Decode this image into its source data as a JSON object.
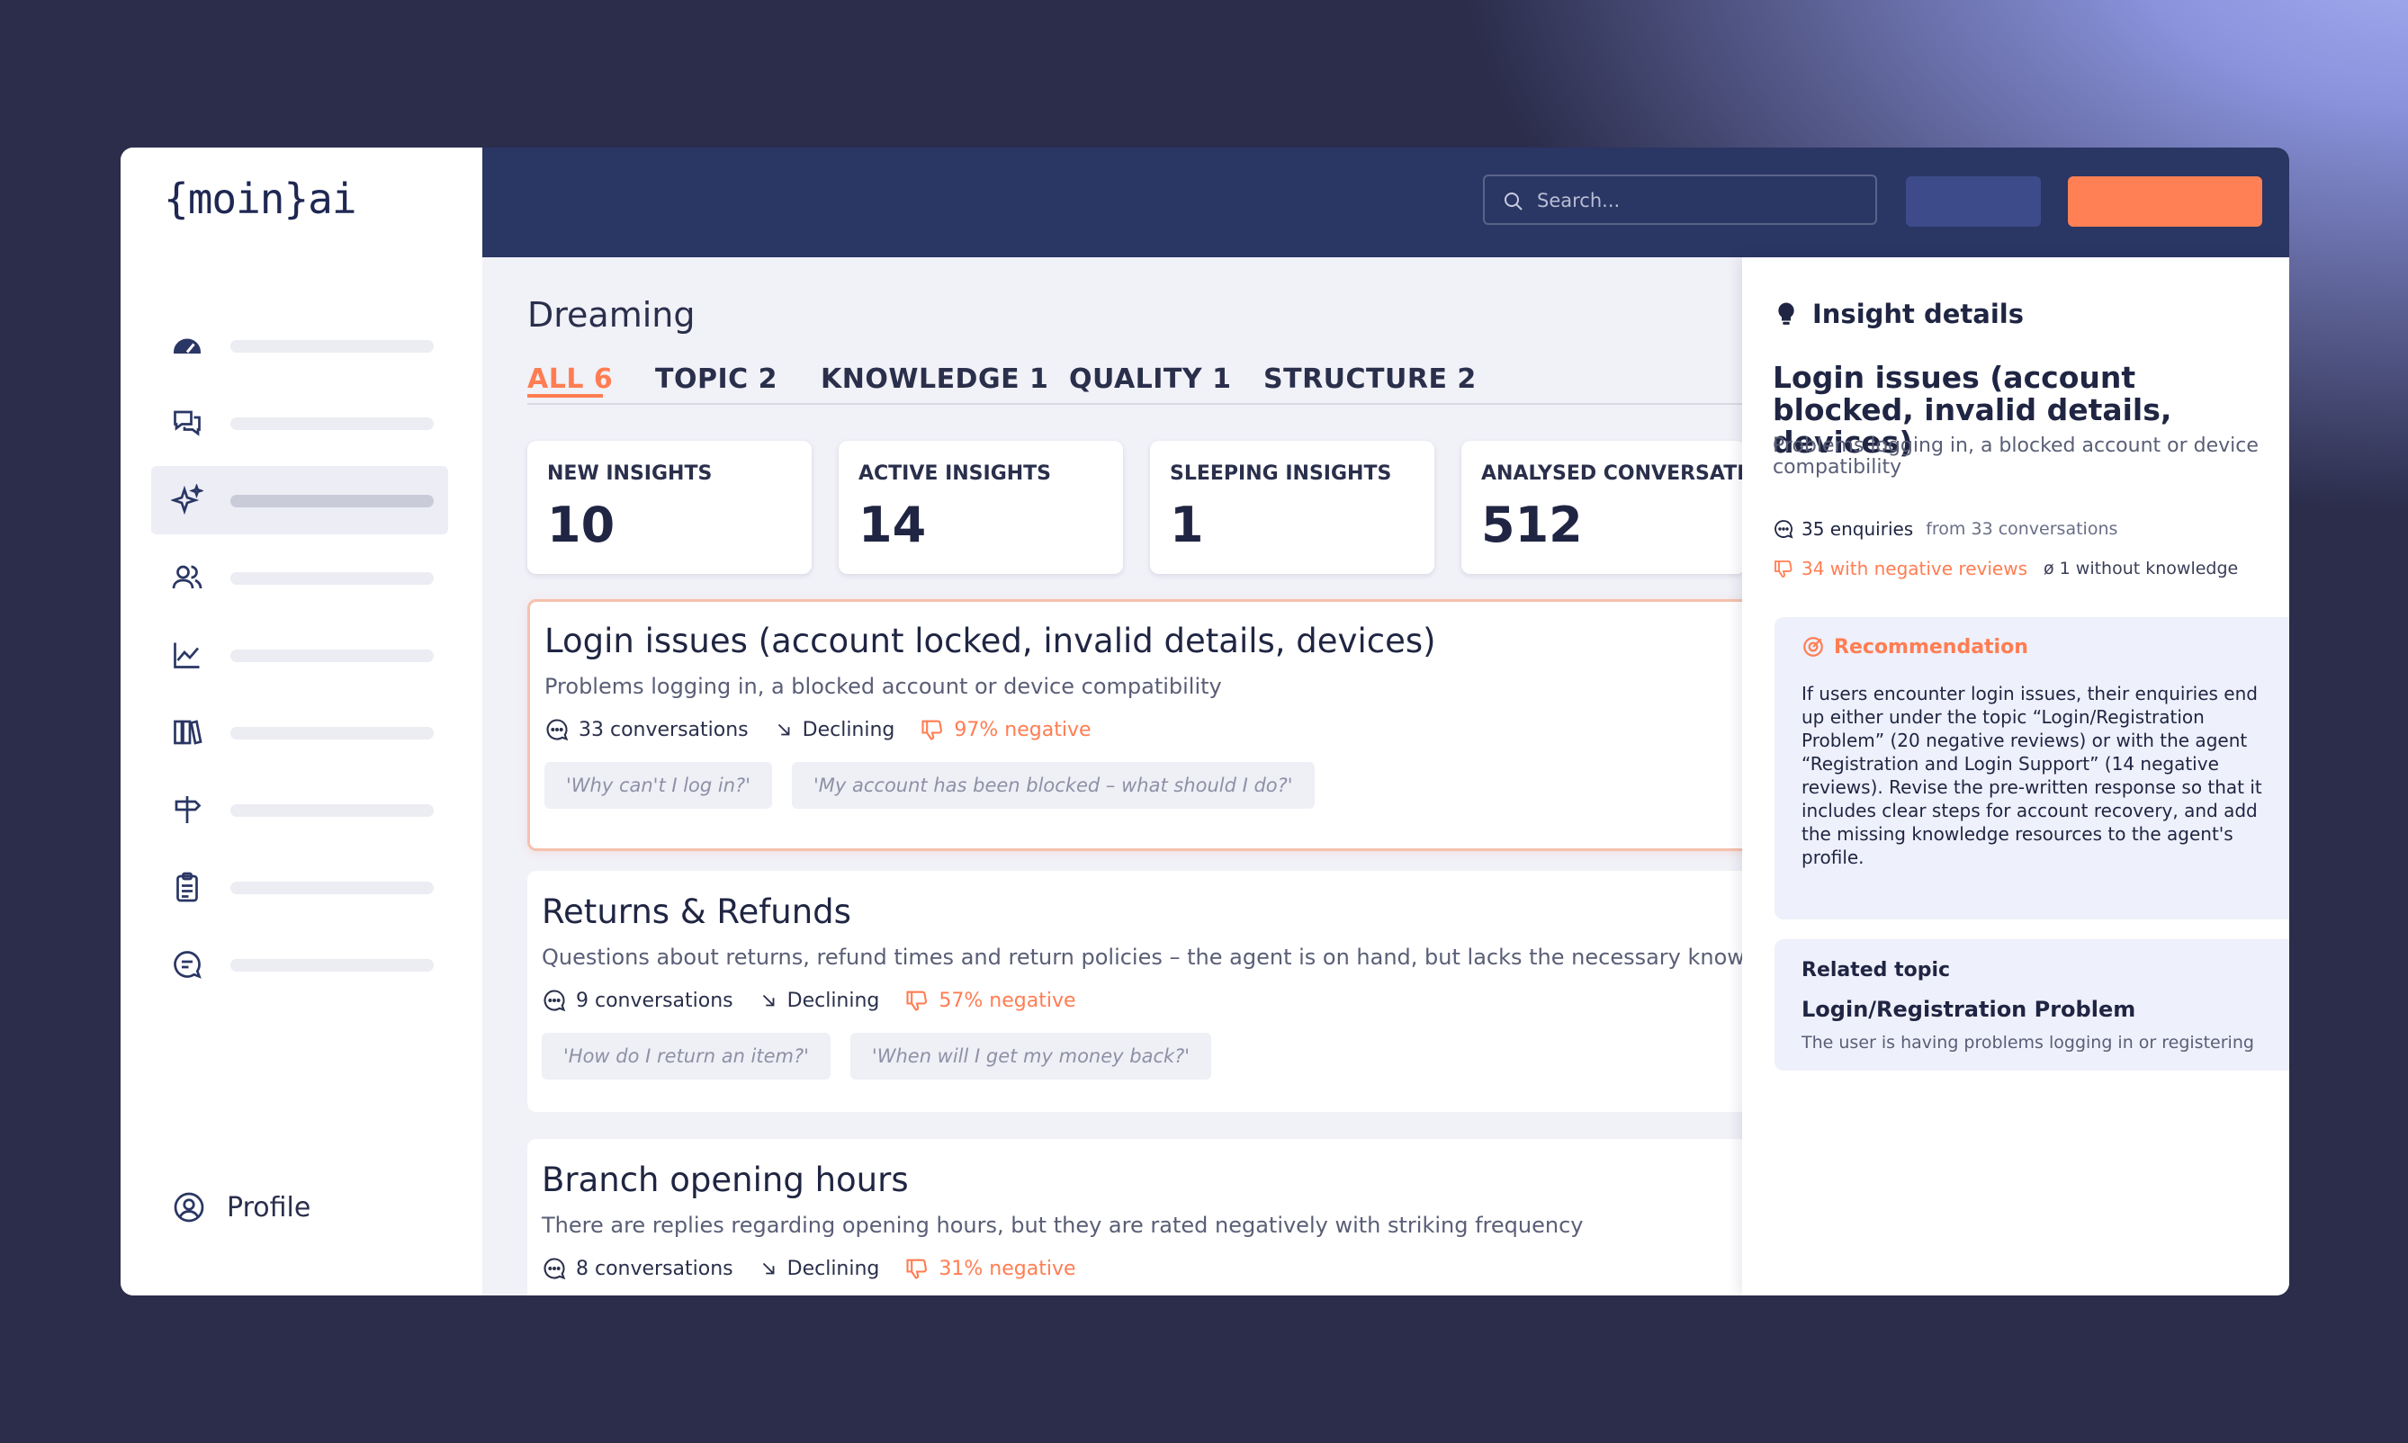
{
  "brand": {
    "logo": "{moin}ai"
  },
  "sidebar": {
    "items": [
      {
        "icon": "gauge-icon"
      },
      {
        "icon": "chat-bubbles-icon"
      },
      {
        "icon": "sparkles-icon",
        "active": true
      },
      {
        "icon": "users-icon"
      },
      {
        "icon": "line-chart-icon"
      },
      {
        "icon": "books-icon"
      },
      {
        "icon": "signpost-icon"
      },
      {
        "icon": "clipboard-icon"
      },
      {
        "icon": "message-icon"
      }
    ],
    "profile_label": "Profile"
  },
  "topbar": {
    "search_placeholder": "Search..."
  },
  "page": {
    "title": "Dreaming",
    "tabs": [
      {
        "label": "ALL 6",
        "active": true
      },
      {
        "label": "TOPIC 2"
      },
      {
        "label": "KNOWLEDGE 1"
      },
      {
        "label": "QUALITY 1"
      },
      {
        "label": "STRUCTURE 2"
      }
    ],
    "stats": [
      {
        "label": "NEW INSIGHTS",
        "value": "10"
      },
      {
        "label": "ACTIVE INSIGHTS",
        "value": "14"
      },
      {
        "label": "SLEEPING INSIGHTS",
        "value": "1"
      },
      {
        "label": "ANALYSED CONVERSATIONS",
        "value": "512"
      }
    ],
    "insights": [
      {
        "title": "Login issues (account locked, invalid details, devices)",
        "description": "Problems logging in, a blocked account or device compatibility",
        "conversations": "33 conversations",
        "trend": "Declining",
        "negative": "97% negative",
        "chips": [
          "'Why can't I log in?'",
          "'My account has been blocked – what should I do?'"
        ]
      },
      {
        "title": "Returns & Refunds",
        "description": "Questions about returns, refund times and return policies – the agent is on hand, but lacks the necessary knowledge.",
        "conversations": "9 conversations",
        "trend": "Declining",
        "negative": "57% negative",
        "chips": [
          "'How do I return an item?'",
          "'When will I get my money back?'"
        ]
      },
      {
        "title": "Branch opening hours",
        "description": "There are replies regarding opening hours, but they are rated negatively with striking frequency",
        "conversations": "8 conversations",
        "trend": "Declining",
        "negative": "31% negative"
      }
    ]
  },
  "panel": {
    "heading": "Insight details",
    "title": "Login issues (account blocked, invalid details, devices)",
    "subtitle": "Problems logging in, a blocked account or device compatibility",
    "enquiries": "35 enquiries",
    "enquiries_from": "from 33 conversations",
    "negative_reviews": "34 with negative reviews",
    "without_knowledge": "ø 1 without knowledge",
    "recommendation_heading": "Recommendation",
    "recommendation_text": "If users encounter login issues, their enquiries end up either under the topic “Login/Registration Problem” (20 negative reviews) or with the agent “Registration and Login Support” (14 negative reviews). Revise the pre-written response so that it includes clear steps for account recovery, and add the missing knowledge resources to the agent's profile.",
    "related_heading": "Related topic",
    "related_title": "Login/Registration Problem",
    "related_sub": "The user is having problems logging in or registering"
  },
  "colors": {
    "accent": "#ff7d52",
    "navy": "#2a3664",
    "text": "#1f2542",
    "background": "#2b2d4b"
  }
}
